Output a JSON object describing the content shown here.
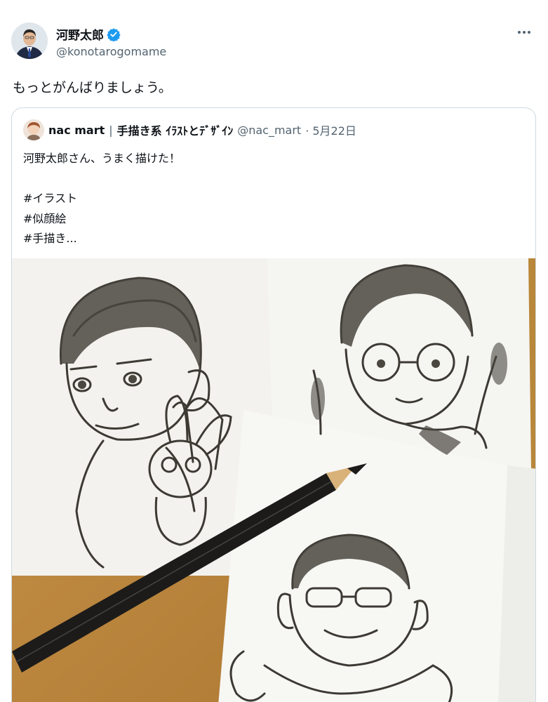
{
  "tweet": {
    "author": {
      "display_name": "河野太郎",
      "handle": "@konotarogomame",
      "verified": true
    },
    "text": "もっとがんばりましょう。",
    "quoted": {
      "author_name": "nac mart",
      "separator": "|",
      "author_bio_name": "手描き系 ｲﾗｽﾄとﾃﾞｻﾞｲﾝ",
      "handle": "@nac_mart",
      "date": "· 5月22日",
      "lines": [
        "河野太郎さん、うまく描けた！",
        "",
        "#イラスト",
        "#似顔絵",
        "#手描き..."
      ],
      "image": "pencil-caricature-sketches-photo"
    }
  },
  "colors": {
    "verified_badge": "#1d9bf0",
    "secondary_text": "#536471",
    "border": "#cfd9de"
  },
  "icons": [
    "verified-badge-icon",
    "more-options-icon"
  ]
}
